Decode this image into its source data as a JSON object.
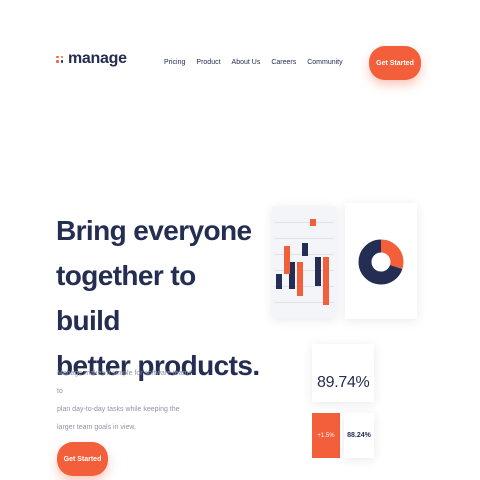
{
  "brand": {
    "name": "manage",
    "accent": "#f25f3a",
    "primary": "#242d52"
  },
  "nav": {
    "items": [
      "Pricing",
      "Product",
      "About Us",
      "Careers",
      "Community"
    ]
  },
  "header": {
    "cta_label": "Get Started"
  },
  "hero": {
    "headline_lines": [
      "Bring everyone",
      "together to build",
      "better products."
    ],
    "description_lines": [
      "Manage makes it simple for software teams to",
      "plan day-to-day tasks while keeping the",
      "larger team goals in view."
    ],
    "cta_label": "Get Started"
  },
  "dashboard": {
    "percent_value": "89.74%",
    "change_value": "+1.5%",
    "secondary_value": "88.24%"
  },
  "chart_data": [
    {
      "type": "bar",
      "series": [
        {
          "color": "#242d52",
          "values": [
            [
              0.62,
              0.78
            ],
            [
              0.5,
              0.78
            ],
            [
              0.3,
              0.44
            ],
            [
              0.45,
              0.75
            ]
          ]
        },
        {
          "color": "#f25f3a",
          "values": [
            [
              0.33,
              0.62
            ],
            [
              0.5,
              0.85
            ],
            [
              0.05,
              0.13
            ],
            [
              0.45,
              0.95
            ]
          ]
        }
      ]
    },
    {
      "type": "pie",
      "values": [
        0.3,
        0.7
      ],
      "colors": [
        "#f25f3a",
        "#242d52"
      ],
      "style": "donut"
    }
  ]
}
